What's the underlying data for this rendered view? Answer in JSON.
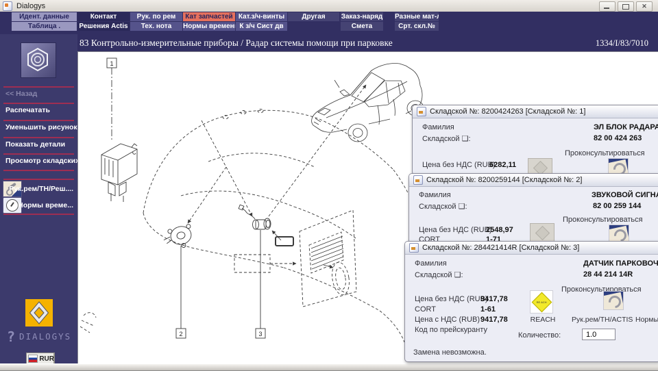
{
  "window": {
    "title": "Dialogys"
  },
  "colors": {
    "accent_tab": "#e5705d",
    "navy_band": "#322f62",
    "sidebar": "#3c3a6c",
    "separator_red": "#9e2e52",
    "renault_yellow": "#f5b200"
  },
  "menu": {
    "row1": [
      "Идент. данные",
      "Контакт",
      "Рук. по рем",
      "Кат запчастей",
      "Кат.з/ч-винты",
      "Другая",
      "Заказ-наряд",
      "Разные мат-лы"
    ],
    "row2": [
      "Таблица .",
      "Решения Actis",
      "Тех. нота",
      "Нормы времени",
      "К з/ч Сист дв",
      "Смета",
      "Срт. скл.№"
    ]
  },
  "header": {
    "title": "83 Контрольно-измерительные приборы / Радар системы помощи при парковке",
    "code": "1334/I/83/7010"
  },
  "sidebar": {
    "back": "<< Назад",
    "print": "Распечатать",
    "shrink": "Уменьшить рисунок",
    "show_details": "Показать детали",
    "view_stock": "Просмотр складских но...",
    "manuals": "Рук.рем/ТН/Реш....",
    "times": "Нормы време...",
    "brand": "DIALOGYS",
    "currency": "RUR"
  },
  "diagram": {
    "callouts": [
      "1",
      "2",
      "3"
    ]
  },
  "dialogs": [
    {
      "title": "Складской №: 8200424263 [Складской №: 1]",
      "name_label": "Фамилия",
      "stock_label": "Складской ❑:",
      "name": "ЭЛ БЛОК РАДАРА ЗАД",
      "stock": "82 00 424 263",
      "consult": "Проконсультироваться",
      "price_label": "Цена без НДС (RUB)",
      "price": "6282,11"
    },
    {
      "title": "Складской №: 8200259144 [Складской №: 2]",
      "name_label": "Фамилия",
      "stock_label": "Складской ❑:",
      "name": "ЗВУКОВОЙ СИГНАЛ ПА",
      "stock": "82 00 259 144",
      "consult": "Проконсультироваться",
      "price_label": "Цена без НДС (RUB)",
      "price": "2548,97",
      "cort_label": "CORT",
      "cort": "1-71"
    },
    {
      "title": "Складской №: 284421414R [Складской №: 3]",
      "name_label": "Фамилия",
      "stock_label": "Складской ❑:",
      "name": "ДАТЧИК ПАРКОВОЧНЫЙ",
      "stock": "28 44 214 14R",
      "consult": "Проконсультироваться",
      "price_label": "Цена без НДС (RUB)",
      "price": "9417,78",
      "cort_label": "CORT",
      "cort": "1-61",
      "price_vat_label": "Цена с НДС (RUB)",
      "price_vat": "9417,78",
      "price_code_label": "Код по прейскуранту",
      "reach_caption": "REACH",
      "reach_logo": "RE ACH",
      "manual_caption": "Рук.рем/TH/ACTIS",
      "times_caption": "Нормы времени",
      "qty_label": "Количество:",
      "qty": "1.0",
      "note": "Замена невозможна."
    }
  ]
}
